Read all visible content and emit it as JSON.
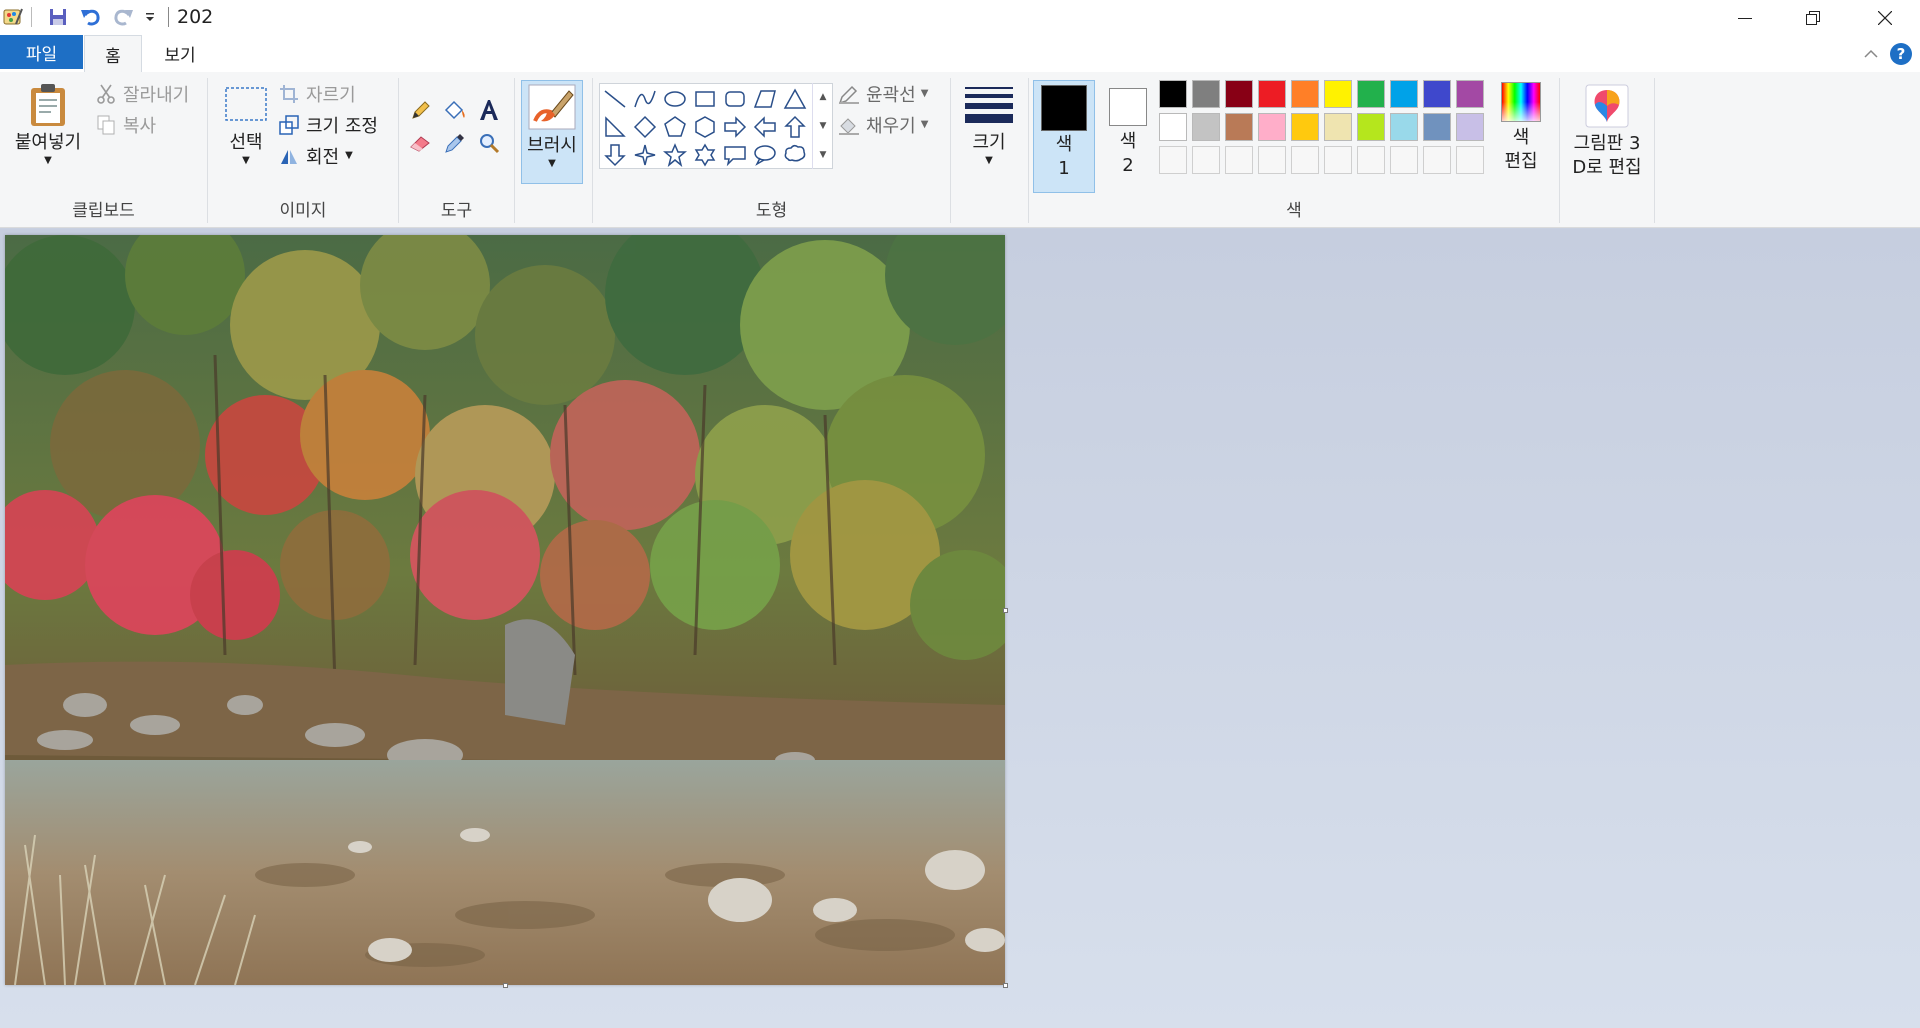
{
  "window": {
    "document_title": "202",
    "controls": [
      "minimize",
      "restore",
      "close"
    ]
  },
  "tabs": {
    "file": "파일",
    "home": "홈",
    "view": "보기",
    "help": "?"
  },
  "clipboard": {
    "paste": "붙여넣기",
    "cut": "잘라내기",
    "copy": "복사",
    "group_label": "클립보드"
  },
  "image": {
    "select": "선택",
    "crop": "자르기",
    "resize": "크기 조정",
    "rotate": "회전",
    "group_label": "이미지"
  },
  "tools": {
    "group_label": "도구",
    "items": [
      "pencil-icon",
      "fill-icon",
      "text-icon",
      "eraser-icon",
      "color-picker-icon",
      "magnifier-icon"
    ]
  },
  "brushes": {
    "label": "브러시"
  },
  "shapes": {
    "group_label": "도형",
    "outline": "윤곽선",
    "fill": "채우기"
  },
  "size": {
    "label": "크기"
  },
  "colors": {
    "group_label": "색",
    "color1_label_a": "색",
    "color1_label_b": "1",
    "color2_label_a": "색",
    "color2_label_b": "2",
    "edit_label_a": "색",
    "edit_label_b": "편집",
    "color1": "#000000",
    "color2": "#ffffff",
    "palette_row1": [
      "#000000",
      "#7f7f7f",
      "#880015",
      "#ed1c24",
      "#ff7f27",
      "#fff200",
      "#22b14c",
      "#00a2e8",
      "#3f48cc",
      "#a349a4"
    ],
    "palette_row2": [
      "#ffffff",
      "#c3c3c3",
      "#b97a57",
      "#ffaec9",
      "#ffc90e",
      "#efe4b0",
      "#b5e61d",
      "#99d9ea",
      "#7092be",
      "#c8bfe7"
    ]
  },
  "paint3d": {
    "label_a": "그림판 3",
    "label_b": "D로 편집"
  }
}
